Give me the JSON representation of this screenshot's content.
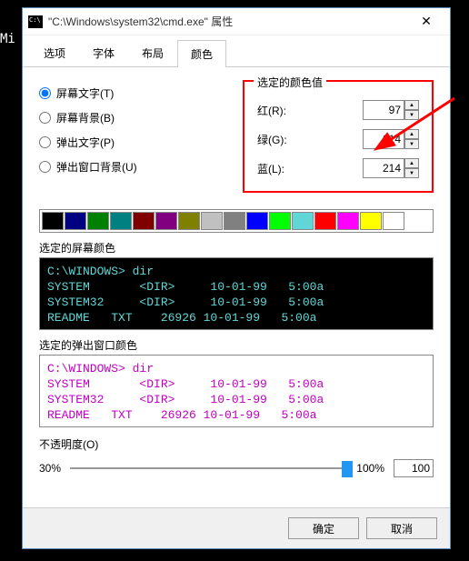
{
  "bgText": "Mi\n(c\n\nC:",
  "window": {
    "title": "\"C:\\Windows\\system32\\cmd.exe\" 属性"
  },
  "tabs": [
    {
      "label": "选项"
    },
    {
      "label": "字体"
    },
    {
      "label": "布局"
    },
    {
      "label": "颜色",
      "active": true
    }
  ],
  "radios": [
    {
      "label": "屏幕文字(T)",
      "checked": true
    },
    {
      "label": "屏幕背景(B)",
      "checked": false
    },
    {
      "label": "弹出文字(P)",
      "checked": false
    },
    {
      "label": "弹出窗口背景(U)",
      "checked": false
    }
  ],
  "rgbGroup": {
    "legend": "选定的颜色值",
    "r": {
      "label": "红(R):",
      "value": "97"
    },
    "g": {
      "label": "绿(G):",
      "value": "214"
    },
    "b": {
      "label": "蓝(L):",
      "value": "214"
    }
  },
  "palette": [
    "#000000",
    "#000080",
    "#008000",
    "#008080",
    "#800000",
    "#800080",
    "#808000",
    "#c0c0c0",
    "#808080",
    "#0000ff",
    "#00ff00",
    "#61d6d6",
    "#ff0000",
    "#ff00ff",
    "#ffff00",
    "#ffffff"
  ],
  "screenPreview": {
    "label": "选定的屏幕颜色",
    "bg": "#000000",
    "fg": "#61d6d6",
    "lines": [
      "C:\\WINDOWS> dir",
      "SYSTEM       <DIR>     10-01-99   5:00a",
      "SYSTEM32     <DIR>     10-01-99   5:00a",
      "README   TXT    26926 10-01-99   5:00a"
    ]
  },
  "popupPreview": {
    "label": "选定的弹出窗口颜色",
    "bg": "#ffffff",
    "fg": "#c000c0",
    "lines": [
      "C:\\WINDOWS> dir",
      "SYSTEM       <DIR>     10-01-99   5:00a",
      "SYSTEM32     <DIR>     10-01-99   5:00a",
      "README   TXT    26926 10-01-99   5:00a"
    ]
  },
  "opacity": {
    "label": "不透明度(O)",
    "min": "30%",
    "max": "100%",
    "value": "100",
    "percent": 100
  },
  "buttons": {
    "ok": "确定",
    "cancel": "取消"
  }
}
